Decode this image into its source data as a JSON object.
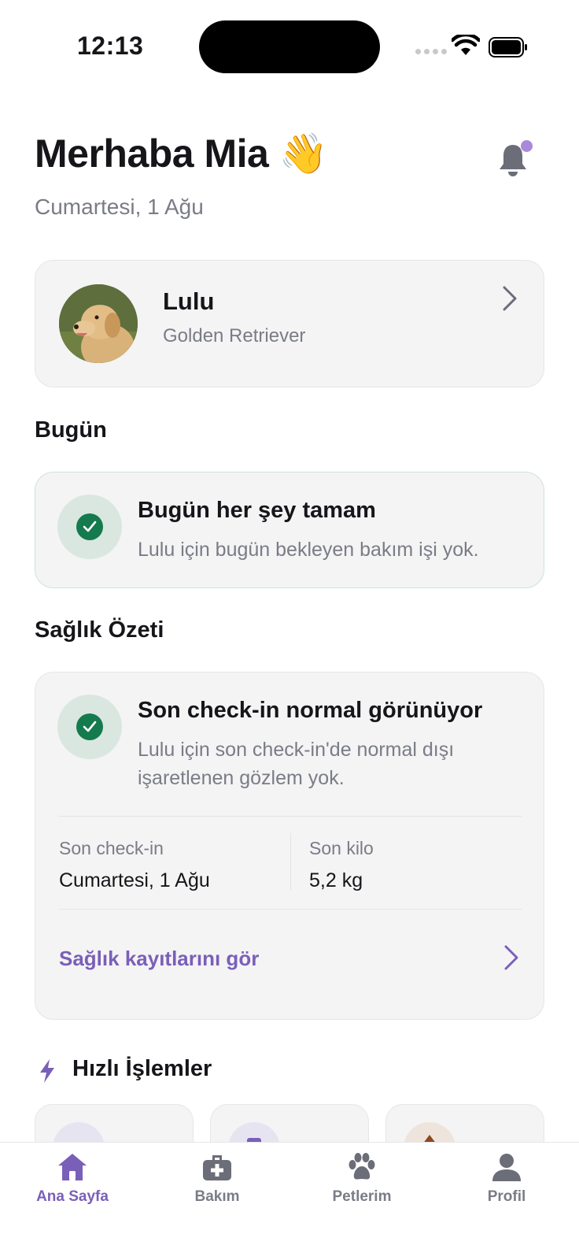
{
  "status_bar": {
    "time": "12:13"
  },
  "header": {
    "greeting": "Merhaba Mia 👋",
    "date": "Cumartesi, 1 Ağu"
  },
  "pet": {
    "name": "Lulu",
    "breed": "Golden Retriever"
  },
  "today": {
    "section_title": "Bugün",
    "title": "Bugün her şey tamam",
    "description": "Lulu için bugün bekleyen bakım işi yok."
  },
  "health": {
    "section_title": "Sağlık Özeti",
    "title": "Son check-in normal görünüyor",
    "description_line1": "Lulu için son check-in'de normal dışı",
    "description_line2": "işaretlenen gözlem yok.",
    "last_checkin_label": "Son check-in",
    "last_checkin_value": "Cumartesi, 1 Ağu",
    "last_weight_label": "Son kilo",
    "last_weight_value": "5,2 kg",
    "link_label": "Sağlık kayıtlarını gör"
  },
  "quick_actions": {
    "title": "Hızlı İşlemler"
  },
  "tabs": [
    {
      "label": "Ana Sayfa",
      "icon": "home-icon",
      "active": true
    },
    {
      "label": "Bakım",
      "icon": "first-aid-kit-icon",
      "active": false
    },
    {
      "label": "Petlerim",
      "icon": "paw-icon",
      "active": false
    },
    {
      "label": "Profil",
      "icon": "user-icon",
      "active": false
    }
  ],
  "colors": {
    "accent": "#7a5fb8",
    "success": "#157a4d",
    "card_bg": "#f4f4f5",
    "muted_text": "#7a7c86"
  }
}
